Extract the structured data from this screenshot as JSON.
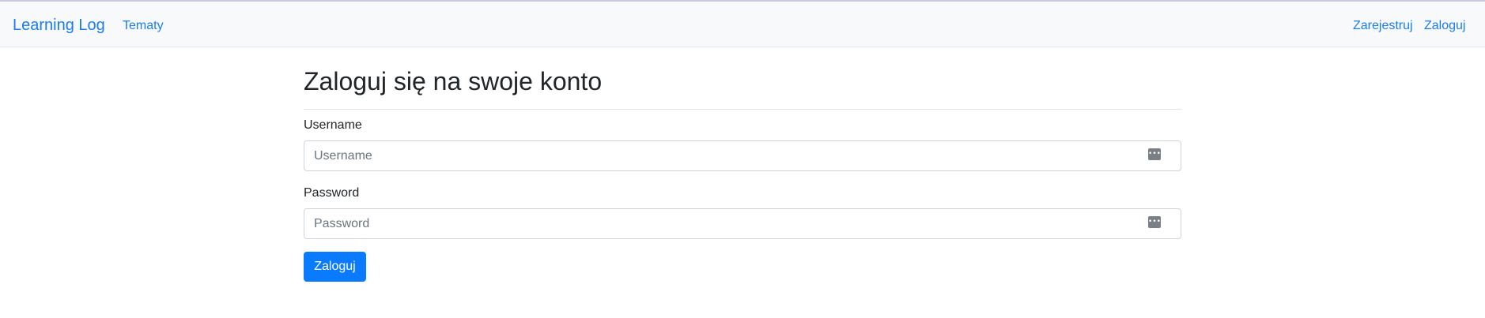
{
  "navbar": {
    "brand": "Learning Log",
    "topics_link": "Tematy",
    "register_link": "Zarejestruj",
    "login_link": "Zaloguj"
  },
  "login_form": {
    "title": "Zaloguj się na swoje konto",
    "username": {
      "label": "Username",
      "placeholder": "Username",
      "value": "",
      "icon": "password-manager-icon"
    },
    "password": {
      "label": "Password",
      "placeholder": "Password",
      "value": "",
      "icon": "password-manager-icon"
    },
    "submit_label": "Zaloguj"
  },
  "colors": {
    "link": "#1a7cf3",
    "navbar_bg": "#f8f9fa",
    "primary_button": "#0a7bff",
    "text": "#212529"
  }
}
